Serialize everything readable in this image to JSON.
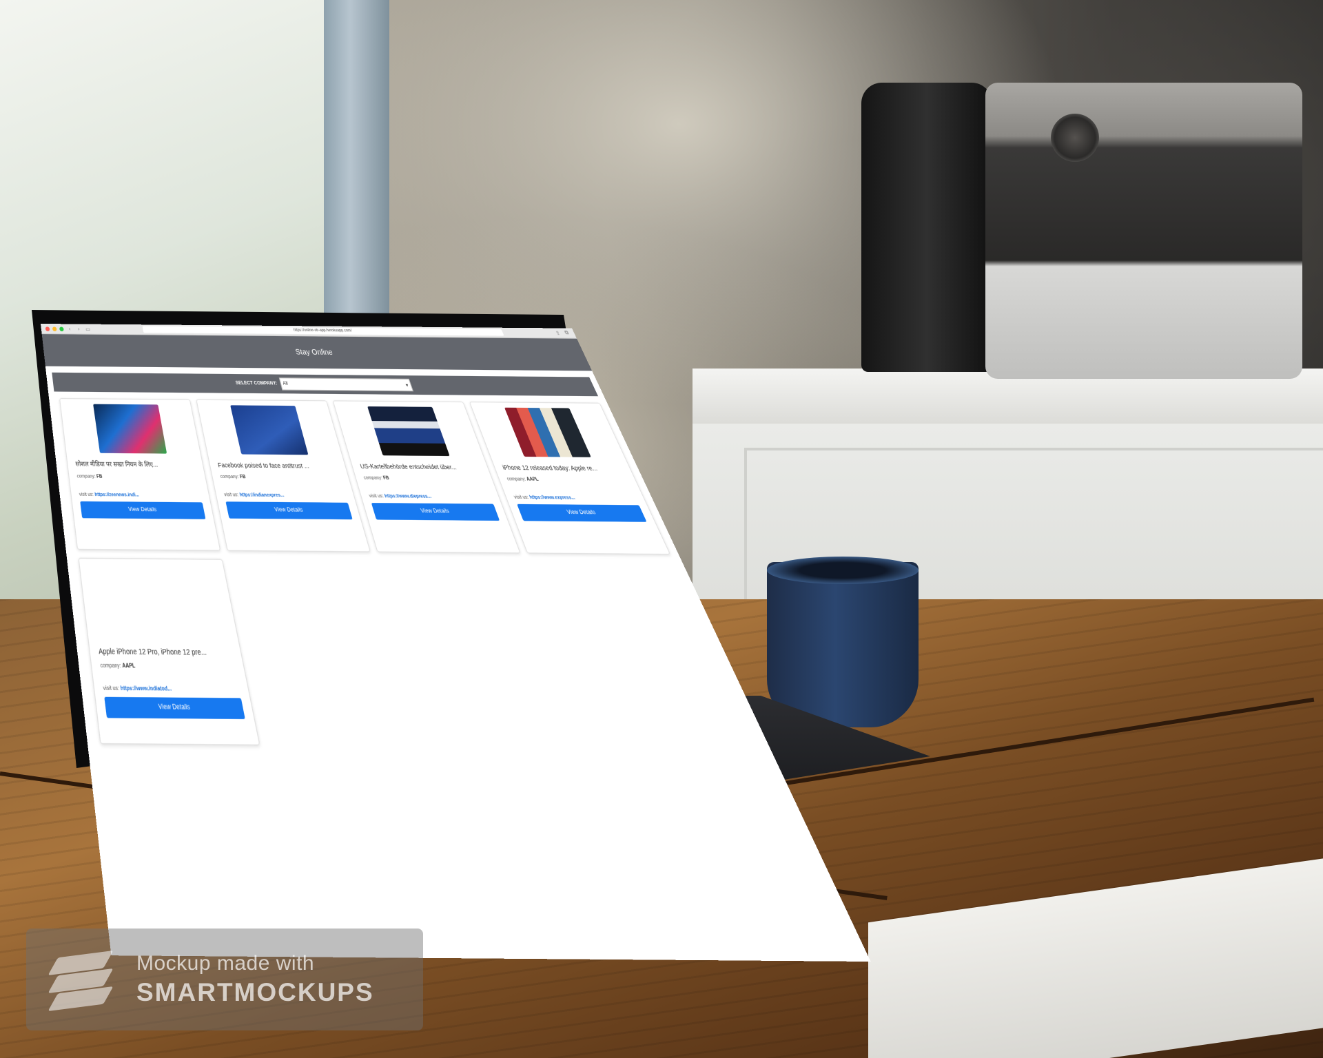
{
  "browser": {
    "url": "https://online-str-app.herokuapp.com/"
  },
  "app": {
    "title": "Stay Online",
    "filter": {
      "label": "SELECT COMPANY:",
      "selected": "All"
    }
  },
  "cards": [
    {
      "title": "सोशल मीडिया पर सख्त नियम के लिए...",
      "company_label": "company:",
      "company": "FB",
      "visit_label": "visit us:",
      "link": "https://zeenews.indi...",
      "button": "View Details",
      "thumb_icon": "social-media-apps-photo"
    },
    {
      "title": "Facebook poised to face antitrust ...",
      "company_label": "company:",
      "company": "FB",
      "visit_label": "visit us:",
      "link": "https://indianexpres...",
      "button": "View Details",
      "thumb_icon": "facebook-logo-photo"
    },
    {
      "title": "US-Kartellbehörde entscheidet über...",
      "company_label": "company:",
      "company": "FB",
      "visit_label": "visit us:",
      "link": "https://www.diepress...",
      "button": "View Details",
      "thumb_icon": "facebook-screen-photo"
    },
    {
      "title": "iPhone 12 released today: Apple re...",
      "company_label": "company:",
      "company": "AAPL",
      "visit_label": "visit us:",
      "link": "https://www.express...",
      "button": "View Details",
      "thumb_icon": "iphone-lineup-photo"
    },
    {
      "title": "Apple iPhone 12 Pro, iPhone 12 pre...",
      "company_label": "company:",
      "company": "AAPL",
      "visit_label": "visit us:",
      "link": "https://www.indiatod...",
      "button": "View Details",
      "thumb_icon": "missing-image"
    }
  ],
  "watermark": {
    "line1": "Mockup made with",
    "line2": "SMARTMOCKUPS"
  },
  "colors": {
    "header_bg": "#63666d",
    "button_bg": "#1779f0",
    "link": "#1a6fd8"
  }
}
